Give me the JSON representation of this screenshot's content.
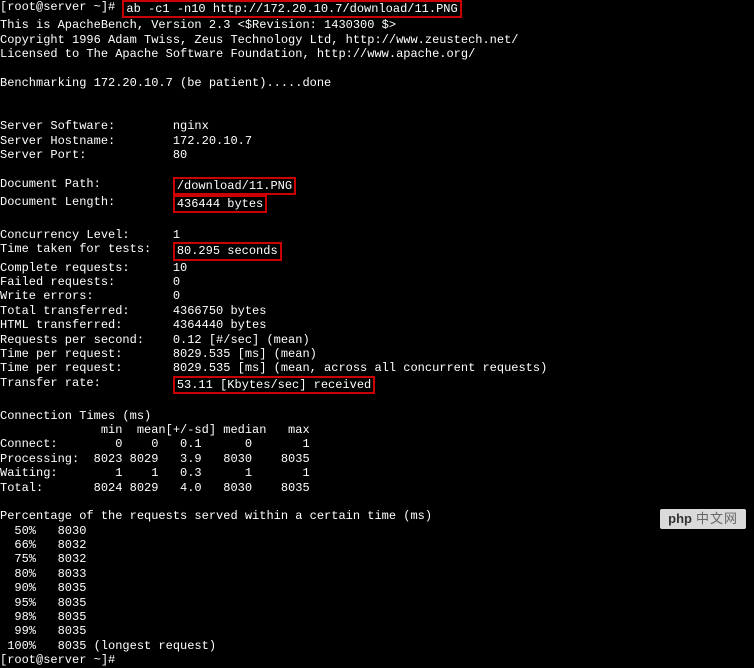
{
  "prompt1": "[root@server ~]# ",
  "command": "ab -c1 -n10 http://172.20.10.7/download/11.PNG",
  "header": {
    "line1": "This is ApacheBench, Version 2.3 <$Revision: 1430300 $>",
    "line2": "Copyright 1996 Adam Twiss, Zeus Technology Ltd, http://www.zeustech.net/",
    "line3": "Licensed to The Apache Software Foundation, http://www.apache.org/"
  },
  "benchmarking": "Benchmarking 172.20.10.7 (be patient).....done",
  "server": {
    "software": "Server Software:        nginx",
    "hostname": "Server Hostname:        172.20.10.7",
    "port": "Server Port:            80"
  },
  "document": {
    "path_label": "Document Path:          ",
    "path_value": "/download/11.PNG",
    "length_label": "Document Length:        ",
    "length_value": "436444 bytes"
  },
  "results": {
    "concurrency": "Concurrency Level:      1",
    "time_label": "Time taken for tests:   ",
    "time_value": "80.295 seconds",
    "complete": "Complete requests:      10",
    "failed": "Failed requests:        0",
    "write_err": "Write errors:           0",
    "total_trans": "Total transferred:      4366750 bytes",
    "html_trans": "HTML transferred:       4364440 bytes",
    "req_sec": "Requests per second:    0.12 [#/sec] (mean)",
    "time_req1": "Time per request:       8029.535 [ms] (mean)",
    "time_req2": "Time per request:       8029.535 [ms] (mean, across all concurrent requests)",
    "transfer_label": "Transfer rate:          ",
    "transfer_value": "53.11 [Kbytes/sec] received"
  },
  "conn_times": {
    "title": "Connection Times (ms)",
    "header": "              min  mean[+/-sd] median   max",
    "connect": "Connect:        0    0   0.1      0       1",
    "process": "Processing:  8023 8029   3.9   8030    8035",
    "waiting": "Waiting:        1    1   0.3      1       1",
    "total": "Total:       8024 8029   4.0   8030    8035"
  },
  "percentiles": {
    "title": "Percentage of the requests served within a certain time (ms)",
    "p50": "  50%   8030",
    "p66": "  66%   8032",
    "p75": "  75%   8032",
    "p80": "  80%   8033",
    "p90": "  90%   8035",
    "p95": "  95%   8035",
    "p98": "  98%   8035",
    "p99": "  99%   8035",
    "p100": " 100%   8035 (longest request)"
  },
  "prompt2": "[root@server ~]# ",
  "watermark": {
    "logo": "php",
    "text": "中文网"
  }
}
